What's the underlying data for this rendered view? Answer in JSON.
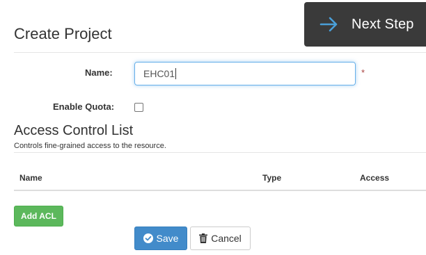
{
  "header": {
    "title": "Create Project",
    "next_step_label": "Next Step",
    "next_step_icon": "arrow-right-icon"
  },
  "form": {
    "name_label": "Name:",
    "name_value": "EHC01",
    "required_marker": "*",
    "quota_label": "Enable Quota:",
    "quota_checked": false
  },
  "acl": {
    "title": "Access Control List",
    "subtitle": "Controls fine-grained access to the resource.",
    "columns": [
      "Name",
      "Type",
      "Access"
    ],
    "add_label": "Add ACL"
  },
  "actions": {
    "save_label": "Save",
    "save_icon": "check-circle-icon",
    "cancel_label": "Cancel",
    "cancel_icon": "trash-icon"
  },
  "colors": {
    "next_step_bg": "#3a3a3a",
    "arrow": "#4a9fd8",
    "add_btn": "#5cb85c",
    "save_btn": "#428bca",
    "required": "#a94442",
    "input_focus": "#66afe9"
  }
}
